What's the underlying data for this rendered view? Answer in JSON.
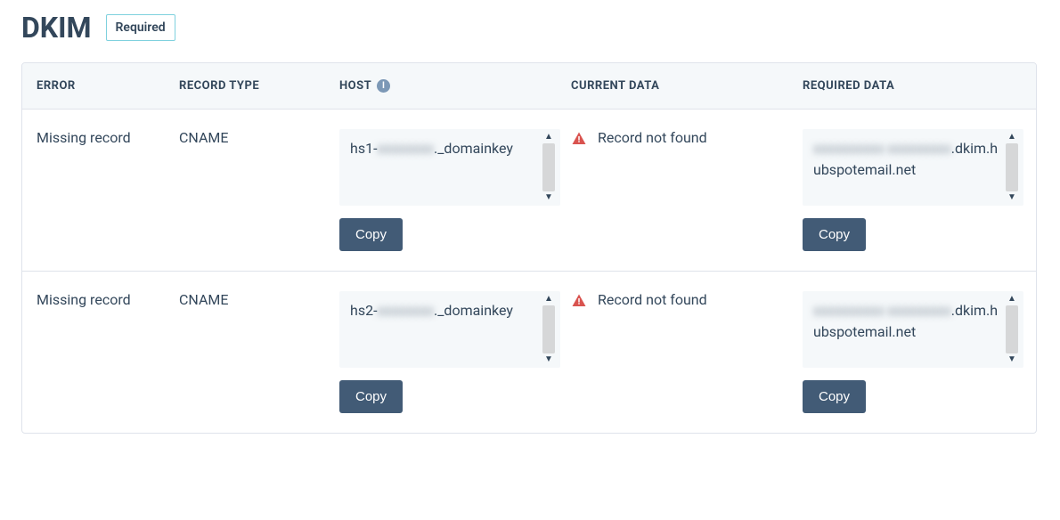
{
  "header": {
    "title": "DKIM",
    "badge": "Required"
  },
  "table": {
    "columns": {
      "error": "ERROR",
      "record_type": "RECORD TYPE",
      "host": "HOST",
      "current_data": "CURRENT DATA",
      "required_data": "REQUIRED DATA"
    },
    "rows": [
      {
        "error": "Missing record",
        "record_type": "CNAME",
        "host_prefix": "hs1-",
        "host_blur": "xxxxxxxx",
        "host_suffix": "._domainkey",
        "current_data": "Record not found",
        "required_blur": "xxxxxxxxxx xxxxxxxxx",
        "required_suffix": ".dkim.hubspotemail.net",
        "copy_label": "Copy"
      },
      {
        "error": "Missing record",
        "record_type": "CNAME",
        "host_prefix": "hs2-",
        "host_blur": "xxxxxxxx",
        "host_suffix": "._domainkey",
        "current_data": "Record not found",
        "required_blur": "xxxxxxxxxx xxxxxxxxx",
        "required_suffix": ".dkim.hubspotemail.net",
        "copy_label": "Copy"
      }
    ]
  },
  "icons": {
    "info": "i"
  }
}
